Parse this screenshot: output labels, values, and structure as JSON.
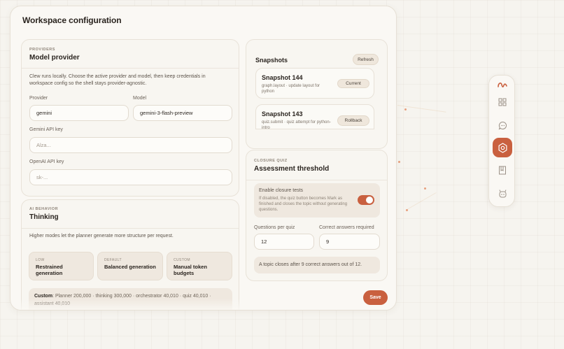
{
  "panel": {
    "title": "Workspace configuration"
  },
  "provider": {
    "kicker": "PROVIDERS",
    "title": "Model provider",
    "description": "Clew runs locally. Choose the active provider and model, then keep credentials in workspace config so the shell stays provider-agnostic.",
    "provider_label": "Provider",
    "provider_value": "gemini",
    "model_label": "Model",
    "model_value": "gemini-3-flash-preview",
    "gemini_label": "Gemini API key",
    "gemini_placeholder": "Alza...",
    "openai_label": "OpenAI API key",
    "openai_placeholder": "sk-..."
  },
  "thinking": {
    "kicker": "AI BEHAVIOR",
    "title": "Thinking",
    "description": "Higher modes let the planner generate more structure per request.",
    "modes": [
      {
        "kicker": "LOW",
        "name": "Restrained generation"
      },
      {
        "kicker": "DEFAULT",
        "name": "Balanced generation"
      },
      {
        "kicker": "CUSTOM",
        "name": "Manual token budgets"
      }
    ],
    "custom_label": "Custom",
    "custom_text": ": Planner 200,000 · thinking 300,000 · orchestrator 40,010 · quiz 40,010 · assistant 40,010"
  },
  "snapshots": {
    "title": "Snapshots",
    "refresh_label": "Refresh",
    "items": [
      {
        "title": "Snapshot 144",
        "subtitle": "graph.layout · update layout for python",
        "action": "Current"
      },
      {
        "title": "Snapshot 143",
        "subtitle": "quiz.submit · quiz attempt for python-intro",
        "action": "Rollback"
      }
    ]
  },
  "quiz": {
    "kicker": "CLOSURE QUIZ",
    "title": "Assessment threshold",
    "toggle_title": "Enable closure tests",
    "toggle_desc": "If disabled, the quiz button becomes Mark as finished and closes the topic without generating questions.",
    "toggle_on": true,
    "questions_label": "Questions per quiz",
    "questions_value": "12",
    "correct_label": "Correct answers required",
    "correct_value": "9",
    "note": "A topic closes after 9 correct answers out of 12."
  },
  "actions": {
    "save_label": "Save"
  },
  "rail": {
    "items": [
      {
        "icon": "logo-icon"
      },
      {
        "icon": "grid-icon"
      },
      {
        "icon": "chat-icon"
      },
      {
        "icon": "settings-icon",
        "active": true
      },
      {
        "icon": "notebook-icon"
      },
      {
        "icon": "bot-icon"
      }
    ],
    "accent": "#c9603f"
  }
}
